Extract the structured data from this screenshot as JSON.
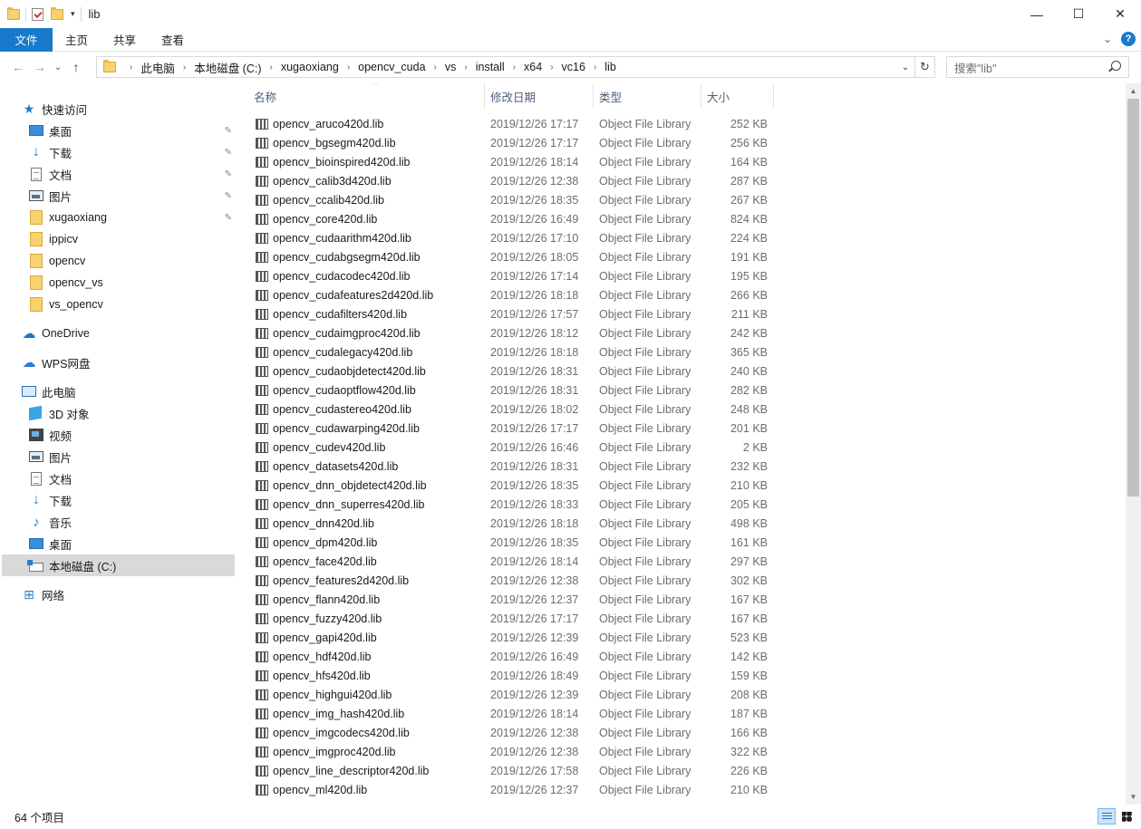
{
  "window": {
    "title": "lib",
    "minimize": "—",
    "maximize": "☐",
    "close": "✕"
  },
  "ribbon": {
    "tabs": [
      "文件",
      "主页",
      "共享",
      "查看"
    ],
    "help": "?",
    "collapse": "⌄"
  },
  "nav": {
    "back": "←",
    "forward": "→",
    "recent": "⌄",
    "up": "↑",
    "breadcrumb": [
      "此电脑",
      "本地磁盘 (C:)",
      "xugaoxiang",
      "opencv_cuda",
      "vs",
      "install",
      "x64",
      "vc16",
      "lib"
    ],
    "breadcrumb_sep": "›",
    "dropdown": "⌄",
    "refresh": "↻",
    "search_placeholder": "搜索\"lib\""
  },
  "sidebar": {
    "quick_access": "快速访问",
    "quick_items": [
      "桌面",
      "下载",
      "文档",
      "图片",
      "xugaoxiang",
      "ippicv",
      "opencv",
      "opencv_vs",
      "vs_opencv"
    ],
    "onedrive": "OneDrive",
    "wps": "WPS网盘",
    "this_pc": "此电脑",
    "pc_items": [
      "3D 对象",
      "视频",
      "图片",
      "文档",
      "下载",
      "音乐",
      "桌面",
      "本地磁盘 (C:)"
    ],
    "network": "网络",
    "pin": "📌"
  },
  "columns": {
    "name": "名称",
    "date": "修改日期",
    "type": "类型",
    "size": "大小",
    "sort_indicator": "^"
  },
  "files": [
    {
      "name": "opencv_aruco420d.lib",
      "date": "2019/12/26 17:17",
      "type": "Object File Library",
      "size": "252 KB"
    },
    {
      "name": "opencv_bgsegm420d.lib",
      "date": "2019/12/26 17:17",
      "type": "Object File Library",
      "size": "256 KB"
    },
    {
      "name": "opencv_bioinspired420d.lib",
      "date": "2019/12/26 18:14",
      "type": "Object File Library",
      "size": "164 KB"
    },
    {
      "name": "opencv_calib3d420d.lib",
      "date": "2019/12/26 12:38",
      "type": "Object File Library",
      "size": "287 KB"
    },
    {
      "name": "opencv_ccalib420d.lib",
      "date": "2019/12/26 18:35",
      "type": "Object File Library",
      "size": "267 KB"
    },
    {
      "name": "opencv_core420d.lib",
      "date": "2019/12/26 16:49",
      "type": "Object File Library",
      "size": "824 KB"
    },
    {
      "name": "opencv_cudaarithm420d.lib",
      "date": "2019/12/26 17:10",
      "type": "Object File Library",
      "size": "224 KB"
    },
    {
      "name": "opencv_cudabgsegm420d.lib",
      "date": "2019/12/26 18:05",
      "type": "Object File Library",
      "size": "191 KB"
    },
    {
      "name": "opencv_cudacodec420d.lib",
      "date": "2019/12/26 17:14",
      "type": "Object File Library",
      "size": "195 KB"
    },
    {
      "name": "opencv_cudafeatures2d420d.lib",
      "date": "2019/12/26 18:18",
      "type": "Object File Library",
      "size": "266 KB"
    },
    {
      "name": "opencv_cudafilters420d.lib",
      "date": "2019/12/26 17:57",
      "type": "Object File Library",
      "size": "211 KB"
    },
    {
      "name": "opencv_cudaimgproc420d.lib",
      "date": "2019/12/26 18:12",
      "type": "Object File Library",
      "size": "242 KB"
    },
    {
      "name": "opencv_cudalegacy420d.lib",
      "date": "2019/12/26 18:18",
      "type": "Object File Library",
      "size": "365 KB"
    },
    {
      "name": "opencv_cudaobjdetect420d.lib",
      "date": "2019/12/26 18:31",
      "type": "Object File Library",
      "size": "240 KB"
    },
    {
      "name": "opencv_cudaoptflow420d.lib",
      "date": "2019/12/26 18:31",
      "type": "Object File Library",
      "size": "282 KB"
    },
    {
      "name": "opencv_cudastereo420d.lib",
      "date": "2019/12/26 18:02",
      "type": "Object File Library",
      "size": "248 KB"
    },
    {
      "name": "opencv_cudawarping420d.lib",
      "date": "2019/12/26 17:17",
      "type": "Object File Library",
      "size": "201 KB"
    },
    {
      "name": "opencv_cudev420d.lib",
      "date": "2019/12/26 16:46",
      "type": "Object File Library",
      "size": "2 KB"
    },
    {
      "name": "opencv_datasets420d.lib",
      "date": "2019/12/26 18:31",
      "type": "Object File Library",
      "size": "232 KB"
    },
    {
      "name": "opencv_dnn_objdetect420d.lib",
      "date": "2019/12/26 18:35",
      "type": "Object File Library",
      "size": "210 KB"
    },
    {
      "name": "opencv_dnn_superres420d.lib",
      "date": "2019/12/26 18:33",
      "type": "Object File Library",
      "size": "205 KB"
    },
    {
      "name": "opencv_dnn420d.lib",
      "date": "2019/12/26 18:18",
      "type": "Object File Library",
      "size": "498 KB"
    },
    {
      "name": "opencv_dpm420d.lib",
      "date": "2019/12/26 18:35",
      "type": "Object File Library",
      "size": "161 KB"
    },
    {
      "name": "opencv_face420d.lib",
      "date": "2019/12/26 18:14",
      "type": "Object File Library",
      "size": "297 KB"
    },
    {
      "name": "opencv_features2d420d.lib",
      "date": "2019/12/26 12:38",
      "type": "Object File Library",
      "size": "302 KB"
    },
    {
      "name": "opencv_flann420d.lib",
      "date": "2019/12/26 12:37",
      "type": "Object File Library",
      "size": "167 KB"
    },
    {
      "name": "opencv_fuzzy420d.lib",
      "date": "2019/12/26 17:17",
      "type": "Object File Library",
      "size": "167 KB"
    },
    {
      "name": "opencv_gapi420d.lib",
      "date": "2019/12/26 12:39",
      "type": "Object File Library",
      "size": "523 KB"
    },
    {
      "name": "opencv_hdf420d.lib",
      "date": "2019/12/26 16:49",
      "type": "Object File Library",
      "size": "142 KB"
    },
    {
      "name": "opencv_hfs420d.lib",
      "date": "2019/12/26 18:49",
      "type": "Object File Library",
      "size": "159 KB"
    },
    {
      "name": "opencv_highgui420d.lib",
      "date": "2019/12/26 12:39",
      "type": "Object File Library",
      "size": "208 KB"
    },
    {
      "name": "opencv_img_hash420d.lib",
      "date": "2019/12/26 18:14",
      "type": "Object File Library",
      "size": "187 KB"
    },
    {
      "name": "opencv_imgcodecs420d.lib",
      "date": "2019/12/26 12:38",
      "type": "Object File Library",
      "size": "166 KB"
    },
    {
      "name": "opencv_imgproc420d.lib",
      "date": "2019/12/26 12:38",
      "type": "Object File Library",
      "size": "322 KB"
    },
    {
      "name": "opencv_line_descriptor420d.lib",
      "date": "2019/12/26 17:58",
      "type": "Object File Library",
      "size": "226 KB"
    },
    {
      "name": "opencv_ml420d.lib",
      "date": "2019/12/26 12:37",
      "type": "Object File Library",
      "size": "210 KB"
    }
  ],
  "status": {
    "count": "64 个项目"
  },
  "colors": {
    "accent": "#1979ca",
    "header_text": "#4c607a",
    "secondary_text": "#6d6d6d",
    "selected_bg": "#d9d9d9"
  }
}
